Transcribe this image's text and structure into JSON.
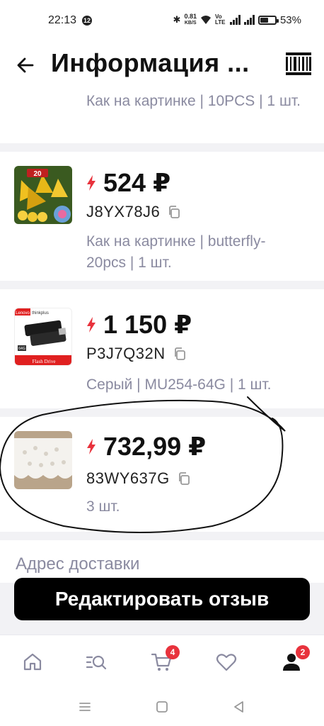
{
  "status_bar": {
    "time": "22:13",
    "notification_count": "12",
    "speed_value": "0.81",
    "speed_unit": "KB/S",
    "volte": "Vo LTE",
    "battery": "53%",
    "battery_level": 0.53
  },
  "header": {
    "title": "Информация ...",
    "back_icon": "arrow-left-icon",
    "barcode_icon": "barcode-icon"
  },
  "items": [
    {
      "desc": "Как на картинке | 10PCS | 1 шт."
    },
    {
      "price": "524 ₽",
      "code": "J8YX78J6",
      "desc": "Как на картинке | butterfly-20pcs | 1 шт.",
      "thumb_label": "20"
    },
    {
      "price": "1 150 ₽",
      "code": "P3J7Q32N",
      "desc": "Серый | MU254-64G | 1 шт.",
      "thumb_brand": "Lenovo",
      "thumb_brand2": "thinkplus",
      "thumb_caption": "Flash Drive",
      "thumb_size": "64G"
    },
    {
      "price": "732,99 ₽",
      "code": "83WY637G",
      "desc": "3 шт."
    }
  ],
  "address_label": "Адрес доставки",
  "cta_label": "Редактировать отзыв",
  "tab_bar": {
    "tabs": [
      {
        "icon": "home-icon"
      },
      {
        "icon": "catalog-search-icon"
      },
      {
        "icon": "cart-icon",
        "badge": "4"
      },
      {
        "icon": "heart-icon"
      },
      {
        "icon": "profile-icon",
        "badge": "2"
      }
    ]
  },
  "colors": {
    "accent": "#e8323c",
    "muted_text": "#8a8aa0",
    "cta_bg": "#000000"
  }
}
